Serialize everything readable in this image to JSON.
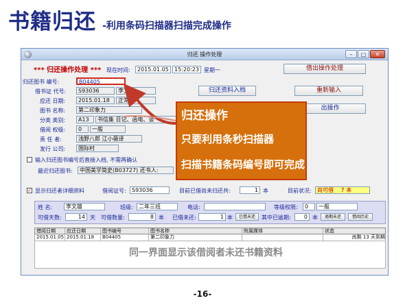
{
  "slide": {
    "title": "书籍归还",
    "subtitle": "-利用条码扫描器扫描完成操作",
    "page_number": "-16-",
    "callout": {
      "line1": "归还操作",
      "line2": "只要利用条秒扫描器",
      "line3": "扫描书籍条码编号即可完成"
    },
    "caption": "同一界面显示该借阅者未还书籍资料"
  },
  "window": {
    "title": "归还 操作处理",
    "header": "*** 归还操作处理 ***",
    "time_label": "现在时间:",
    "date": "2015.01.05",
    "time": "15:20:23",
    "weekday": "星期一"
  },
  "form": {
    "book_no_label": "归还图书  编号:",
    "book_no": "B04405",
    "borrower_label": "借书证  代号:",
    "borrower_code": "S93036",
    "borrower_name": "李文雄",
    "due_label": "应还  日期:",
    "due_date": "2015.01.18",
    "status": "正常",
    "name_label": "图书  名称:",
    "book_name": "第二印象力",
    "category_label": "分类  类别:",
    "category_code": "A13",
    "category_text": "书信集 日记、函电、谈",
    "level_label": "借阅  权级:",
    "level_code": "0",
    "level_text": "一般",
    "author_label": "责  任 者:",
    "author": "浅野八郎 江小薇译",
    "publisher_label": "发行  公司:",
    "publisher": "国际村",
    "confirm_label": "输入归还图书编号后直接入档, 不需再确认",
    "recent_label": "最近归还图书:",
    "recent": "中国美学简史(B03727) 还书人:"
  },
  "buttons": {
    "borrow": "借出操作处理",
    "save": "归还资料入档",
    "reenter": "重新输入",
    "borrow_partial": "出操作",
    "unreturned": "已借未还",
    "overdue": "逾期未还",
    "history": "借阅历史"
  },
  "reader": {
    "show_label": "显示归还者详细资料",
    "card_label": "借阅证号:",
    "card_no": "S93036",
    "unreturned_label": "目前已借尚未归还共:",
    "unreturned_count": "1",
    "unreturned_unit": "本",
    "status_label": "目前状况:",
    "status_value": "尚可借",
    "status_count": "7",
    "status_unit": "本",
    "name_label": "姓    名:",
    "name": "李文雄",
    "class_label": "班级:",
    "class": "二年三班",
    "phone_label": "电话:",
    "phone": "",
    "level_label": "等级权限:",
    "level_code": "0",
    "level_text": "一般",
    "days_label": "可借天数:",
    "days": "14",
    "days_unit": "天",
    "qty_label": "可借数量:",
    "qty": "8",
    "qty_unit": "本",
    "borrowed_label": "已借未还:",
    "borrowed": "1",
    "borrowed_unit": "本",
    "overdue_label": "其中已逾期:",
    "overdue": "0",
    "overdue_unit": "本"
  },
  "table": {
    "headers": [
      "借阅日期",
      "应还日期",
      "图书编号",
      "图书名称",
      "附属媒体",
      "状态"
    ],
    "rows": [
      [
        "2015.01.05",
        "2015.01.18",
        "B04405",
        "第二印象力",
        "",
        "尚剩  13 天到期"
      ]
    ]
  },
  "colors": {
    "title_blue": "#1f2d86",
    "callout_fill": "#d6700c",
    "callout_border": "#c63a0a",
    "arrow_red": "#c0392b",
    "status_yellow": "#ffff80"
  }
}
